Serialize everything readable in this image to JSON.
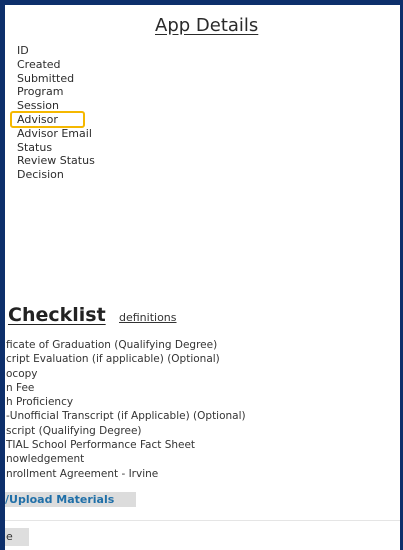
{
  "app_details": {
    "title": "App Details",
    "fields": [
      "ID",
      "Created",
      "Submitted",
      "Program",
      "Session",
      "Advisor",
      "Advisor Email",
      "Status",
      "Review Status",
      "Decision"
    ]
  },
  "checklist": {
    "title": "Checklist",
    "definitions_link": "definitions",
    "items": [
      "ficate of Graduation (Qualifying Degree)",
      "cript Evaluation (if applicable) (Optional)",
      "ocopy",
      "n Fee",
      "h Proficiency",
      "-Unofficial Transcript (if Applicable) (Optional)",
      "script (Qualifying Degree)",
      "TIAL School Performance Fact Sheet",
      "nowledgement",
      "nrollment Agreement - Irvine"
    ],
    "upload_label": "/Upload Materials"
  },
  "footer": {
    "button_label": "e"
  },
  "colors": {
    "frame": "#0d2f6b",
    "highlight": "#f5b800",
    "link_blue": "#1f6fa8"
  }
}
